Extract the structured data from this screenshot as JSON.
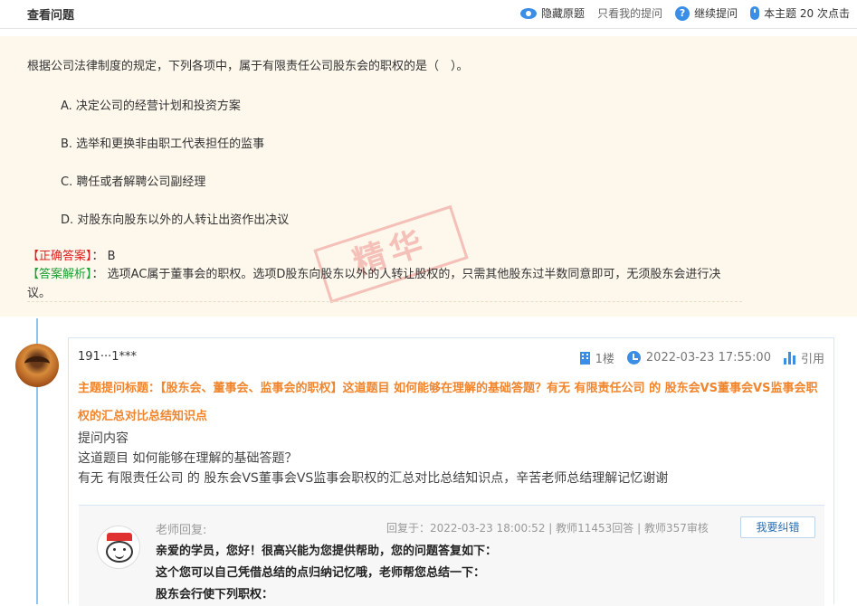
{
  "topbar": {
    "title": "查看问题",
    "hide_label": "隐藏原题",
    "only_mine_label": "只看我的提问",
    "continue_label": "继续提问",
    "clicks_label": "本主题 20 次点击"
  },
  "question": {
    "text": "根据公司法律制度的规定，下列各项中，属于有限责任公司股东会的职权的是（　）。",
    "options": [
      "A. 决定公司的经营计划和投资方案",
      "B. 选举和更换非由职工代表担任的监事",
      "C. 聘任或者解聘公司副经理",
      "D. 对股东向股东以外的人转让出资作出决议"
    ],
    "answer_tag": "【正确答案】",
    "answer_sep": "：",
    "answer_value": "B",
    "analysis_tag": "【答案解析】",
    "analysis_sep": "：",
    "analysis_text": "选项AC属于董事会的职权。选项D股东向股东以外的人转让股权的，只需其他股东过半数同意即可，无须股东会进行决议。",
    "stamp": "精华"
  },
  "post": {
    "user": "191···1***",
    "floor": "1楼",
    "time": "2022-03-23 17:55:00",
    "quote_label": "引用",
    "topic_title": "主题提问标题：【股东会、董事会、监事会的职权】这道题目 如何能够在理解的基础答题？有无 有限责任公司 的 股东会VS董事会VS监事会职权的汇总对比总结知识点",
    "content_label": "提问内容",
    "content_line1": "这道题目 如何能够在理解的基础答题？",
    "content_line2": "有无 有限责任公司 的 股东会VS董事会VS监事会职权的汇总对比总结知识点，辛苦老师总结理解记忆谢谢"
  },
  "reply": {
    "label": "老师回复:",
    "meta": "回复于：2022-03-23 18:00:52 | 教师11453回答 | 教师357审核",
    "report_button": "我要纠错",
    "line1": "亲爱的学员，您好！很高兴能为您提供帮助，您的问题答复如下：",
    "line2": "这个您可以自己凭借总结的点归纳记忆哦，老师帮您总结一下：",
    "line3": "股东会行使下列职权："
  }
}
